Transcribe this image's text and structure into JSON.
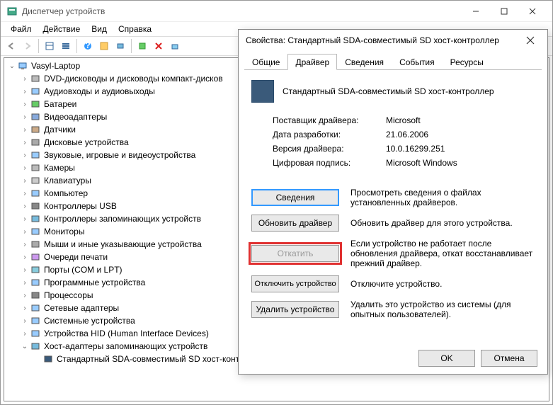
{
  "window": {
    "title": "Диспетчер устройств"
  },
  "menubar": {
    "file": "Файл",
    "action": "Действие",
    "view": "Вид",
    "help": "Справка"
  },
  "tree": {
    "root": "Vasyl-Laptop",
    "items": [
      "DVD-дисководы и дисководы компакт-дисков",
      "Аудиовходы и аудиовыходы",
      "Батареи",
      "Видеоадаптеры",
      "Датчики",
      "Дисковые устройства",
      "Звуковые, игровые и видеоустройства",
      "Камеры",
      "Клавиатуры",
      "Компьютер",
      "Контроллеры USB",
      "Контроллеры запоминающих устройств",
      "Мониторы",
      "Мыши и иные указывающие устройства",
      "Очереди печати",
      "Порты (COM и LPT)",
      "Программные устройства",
      "Процессоры",
      "Сетевые адаптеры",
      "Системные устройства",
      "Устройства HID (Human Interface Devices)",
      "Хост-адаптеры запоминающих устройств"
    ],
    "expanded_child": "Стандартный SDA-совместимый SD хост-контроллер"
  },
  "dialog": {
    "title": "Свойства: Стандартный SDA-совместимый SD хост-контроллер",
    "tabs": {
      "general": "Общие",
      "driver": "Драйвер",
      "details": "Сведения",
      "events": "События",
      "resources": "Ресурсы"
    },
    "device_name": "Стандартный SDA-совместимый SD хост-контроллер",
    "rows": {
      "provider_k": "Поставщик драйвера:",
      "provider_v": "Microsoft",
      "date_k": "Дата разработки:",
      "date_v": "21.06.2006",
      "version_k": "Версия драйвера:",
      "version_v": "10.0.16299.251",
      "sig_k": "Цифровая подпись:",
      "sig_v": "Microsoft Windows"
    },
    "buttons": {
      "details": "Сведения",
      "details_desc": "Просмотреть сведения о файлах установленных драйверов.",
      "update": "Обновить драйвер",
      "update_desc": "Обновить драйвер для этого устройства.",
      "rollback": "Откатить",
      "rollback_desc": "Если устройство не работает после обновления драйвера, откат восстанавливает прежний драйвер.",
      "disable": "Отключить устройство",
      "disable_desc": "Отключите устройство.",
      "uninstall": "Удалить устройство",
      "uninstall_desc": "Удалить это устройство из системы (для опытных пользователей)."
    },
    "footer": {
      "ok": "OK",
      "cancel": "Отмена"
    }
  }
}
